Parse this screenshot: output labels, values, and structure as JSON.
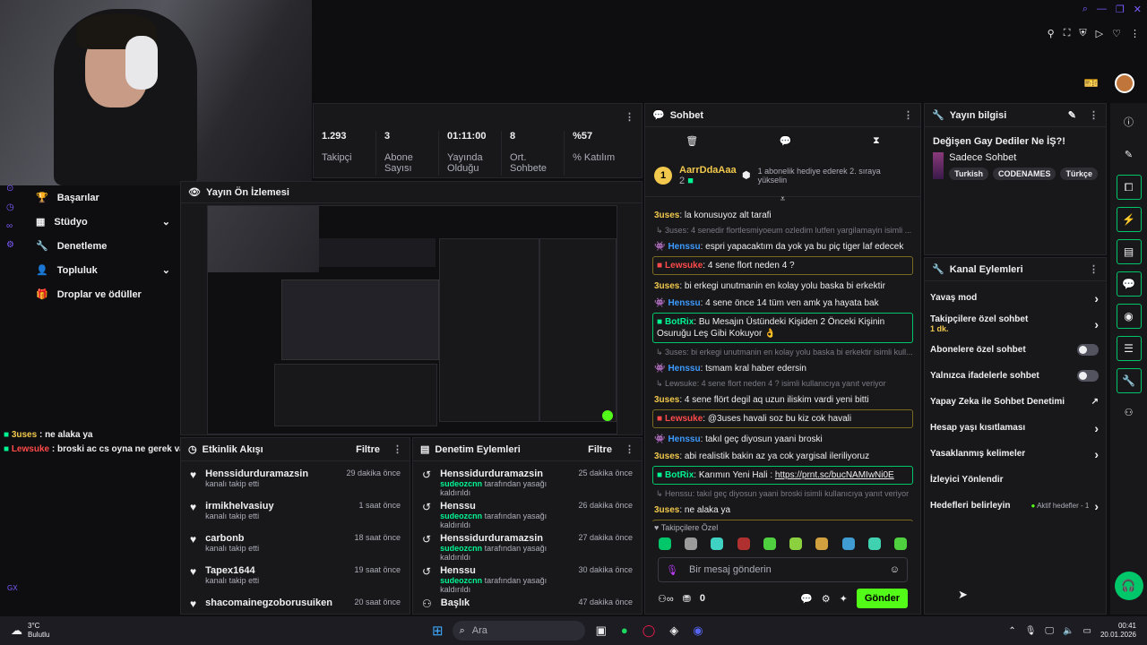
{
  "stats": [
    {
      "value": "1.293",
      "label": "Takipçi"
    },
    {
      "value": "3",
      "label": "Abone Sayısı"
    },
    {
      "value": "01:11:00",
      "label": "Yayında Olduğu"
    },
    {
      "value": "8",
      "label": "Ort. Sohbete"
    },
    {
      "value": "%57",
      "label": "% Katılım"
    }
  ],
  "nav": [
    {
      "label": "Başarılar",
      "icon": "trophy-icon"
    },
    {
      "label": "Stüdyo",
      "icon": "studio-icon",
      "chev": "⌄"
    },
    {
      "label": "Denetleme",
      "icon": "wrench-icon"
    },
    {
      "label": "Topluluk",
      "icon": "person-icon",
      "chev": "⌄"
    },
    {
      "label": "Droplar ve ödüller",
      "icon": "gift-icon"
    }
  ],
  "preview": {
    "title": "Yayın Ön İzlemesi"
  },
  "overlay_chat": [
    {
      "user": "3uses",
      "text": "ne alaka ya",
      "color": "#f2c94c"
    },
    {
      "user": "Lewsuke",
      "text": "broski ac cs oyna ne gerek var takil gec ne",
      "color": "#ff4a4a"
    }
  ],
  "activity": {
    "title": "Etkinlik Akışı",
    "filter": "Filtre",
    "items": [
      {
        "name": "Henssidurduramazsin",
        "sub": "kanalı takip etti",
        "time": "29 dakika önce"
      },
      {
        "name": "irmikhelvasiuy",
        "sub": "kanalı takip etti",
        "time": "1 saat önce"
      },
      {
        "name": "carbonb",
        "sub": "kanalı takip etti",
        "time": "18 saat önce"
      },
      {
        "name": "Tapex1644",
        "sub": "kanalı takip etti",
        "time": "19 saat önce"
      },
      {
        "name": "shacomainegzoborusuiken",
        "sub": "",
        "time": "20 saat önce"
      }
    ]
  },
  "moderation": {
    "title": "Denetim Eylemleri",
    "filter": "Filtre",
    "items": [
      {
        "name": "Henssidurduramazsin",
        "mod": "sudeozcnn",
        "sub": "tarafından yasağı kaldırıldı",
        "time": "25 dakika önce"
      },
      {
        "name": "Henssu",
        "mod": "sudeozcnn",
        "sub": "tarafından yasağı kaldırıldı",
        "time": "26 dakika önce"
      },
      {
        "name": "Henssidurduramazsin",
        "mod": "sudeozcnn",
        "sub": "tarafından yasağı kaldırıldı",
        "time": "27 dakika önce"
      },
      {
        "name": "Henssu",
        "mod": "sudeozcnn",
        "sub": "tarafından yasağı kaldırıldı",
        "time": "30 dakika önce"
      },
      {
        "name": "Başlık",
        "mod": "",
        "sub": "",
        "time": "47 dakika önce"
      }
    ]
  },
  "chat": {
    "title": "Sohbet",
    "pinned_user": "AarrDdaAaa",
    "pinned_count": "2",
    "pinned_rank": "1",
    "pinned_text": "1 abonelik hediye ederek 2. sıraya yükselin",
    "messages": [
      {
        "type": "msg",
        "user": "3uses",
        "ucolor": "#f2c94c",
        "text": "la konusuyoz alt tarafi"
      },
      {
        "type": "reply",
        "text": "3uses: 4 senedir flortlesmiyoeum ozledim lutfen yargilamayin isimli ..."
      },
      {
        "type": "msg",
        "user": "Henssu",
        "ucolor": "#3d9bff",
        "text": "espri yapacaktım da yok ya bu piç tiger laf edecek"
      },
      {
        "type": "box",
        "user": "Lewsuke",
        "ucolor": "#ff4a4a",
        "text": "4 sene flort neden 4 ?"
      },
      {
        "type": "msg",
        "user": "3uses",
        "ucolor": "#f2c94c",
        "text": "bi erkegi unutmanin en kolay yolu baska bi erkektir"
      },
      {
        "type": "msg",
        "user": "Henssu",
        "ucolor": "#3d9bff",
        "text": "4 sene önce 14 tüm ven amk ya hayata bak"
      },
      {
        "type": "box",
        "user": "BotRix",
        "ucolor": "#00f593",
        "text": "Bu Mesajın Üstündeki Kişiden 2 Önceki Kişinin Osuruğu Leş Gibi Kokuyor 👌"
      },
      {
        "type": "reply",
        "text": "3uses: bi erkegi unutmanin en kolay yolu baska bi erkektir isimli kull..."
      },
      {
        "type": "msg",
        "user": "Henssu",
        "ucolor": "#3d9bff",
        "text": "tsmam kral haber edersin"
      },
      {
        "type": "reply",
        "text": "Lewsuke: 4 sene flort neden 4 ? isimli kullanıcıya yanıt veriyor"
      },
      {
        "type": "msg",
        "user": "3uses",
        "ucolor": "#f2c94c",
        "text": "4 sene flört degil aq uzun iliskim vardi yeni bitti"
      },
      {
        "type": "box",
        "user": "Lewsuke",
        "ucolor": "#ff4a4a",
        "text": "@3uses havali soz bu kiz cok havali"
      },
      {
        "type": "msg",
        "user": "Henssu",
        "ucolor": "#3d9bff",
        "text": "takıl geç diyosun yaani broski"
      },
      {
        "type": "msg",
        "user": "3uses",
        "ucolor": "#f2c94c",
        "text": "abi realistik bakin az ya cok yargisal ileriliyoruz"
      },
      {
        "type": "box",
        "user": "BotRix",
        "ucolor": "#00f593",
        "text": "Karımın Yeni Hali : https://prnt.sc/bucNAMIwNi0E"
      },
      {
        "type": "reply",
        "text": "Henssu: takıl geç diyosun yaani broski isimli kullanıcıya yanıt veriyor"
      },
      {
        "type": "msg",
        "user": "3uses",
        "ucolor": "#f2c94c",
        "text": "ne alaka ya"
      },
      {
        "type": "box",
        "user": "Lewsuke",
        "ucolor": "#ff4a4a",
        "text": "broski ac cs oyna ne gerek var takil gec ne"
      }
    ],
    "emote_label": "Takipçilere Özel",
    "input_placeholder": "Bir mesaj gönderin",
    "points": "0",
    "send": "Gönder"
  },
  "info": {
    "title": "Yayın bilgisi",
    "stream_title": "Değişen Gay Dediler Ne İŞ?!",
    "category": "Sadece Sohbet",
    "tags": [
      "Turkish",
      "CODENAMES",
      "Türkçe"
    ]
  },
  "actions": {
    "title": "Kanal Eylemleri",
    "items": [
      {
        "label": "Yavaş mod",
        "sub": "",
        "ctl": "›"
      },
      {
        "label": "Takipçilere özel sohbet",
        "sub": "1 dk.",
        "ctl": "›"
      },
      {
        "label": "Abonelere özel sohbet",
        "sub": "",
        "ctl": "toggle"
      },
      {
        "label": "Yalnızca ifadelerle sohbet",
        "sub": "",
        "ctl": "toggle"
      },
      {
        "label": "Yapay Zeka ile Sohbet Denetimi",
        "sub": "",
        "ctl": "↗"
      },
      {
        "label": "Hesap yaşı kısıtlaması",
        "sub": "",
        "ctl": "›"
      },
      {
        "label": "Yasaklanmış kelimeler",
        "sub": "",
        "ctl": "›"
      },
      {
        "label": "İzleyici Yönlendir",
        "sub": "",
        "ctl": ""
      },
      {
        "label": "Hedefleri belirleyin",
        "sub": "",
        "ctl": "›",
        "extra": "Aktif hedefler - 1"
      }
    ]
  },
  "taskbar": {
    "temp": "3°C",
    "weather": "Bulutlu",
    "search": "Ara",
    "time": "00:41",
    "date": "20.01.2026"
  },
  "colors": {
    "accent": "#53fc18",
    "bg": "#0e0e10",
    "panel": "#18181b"
  }
}
